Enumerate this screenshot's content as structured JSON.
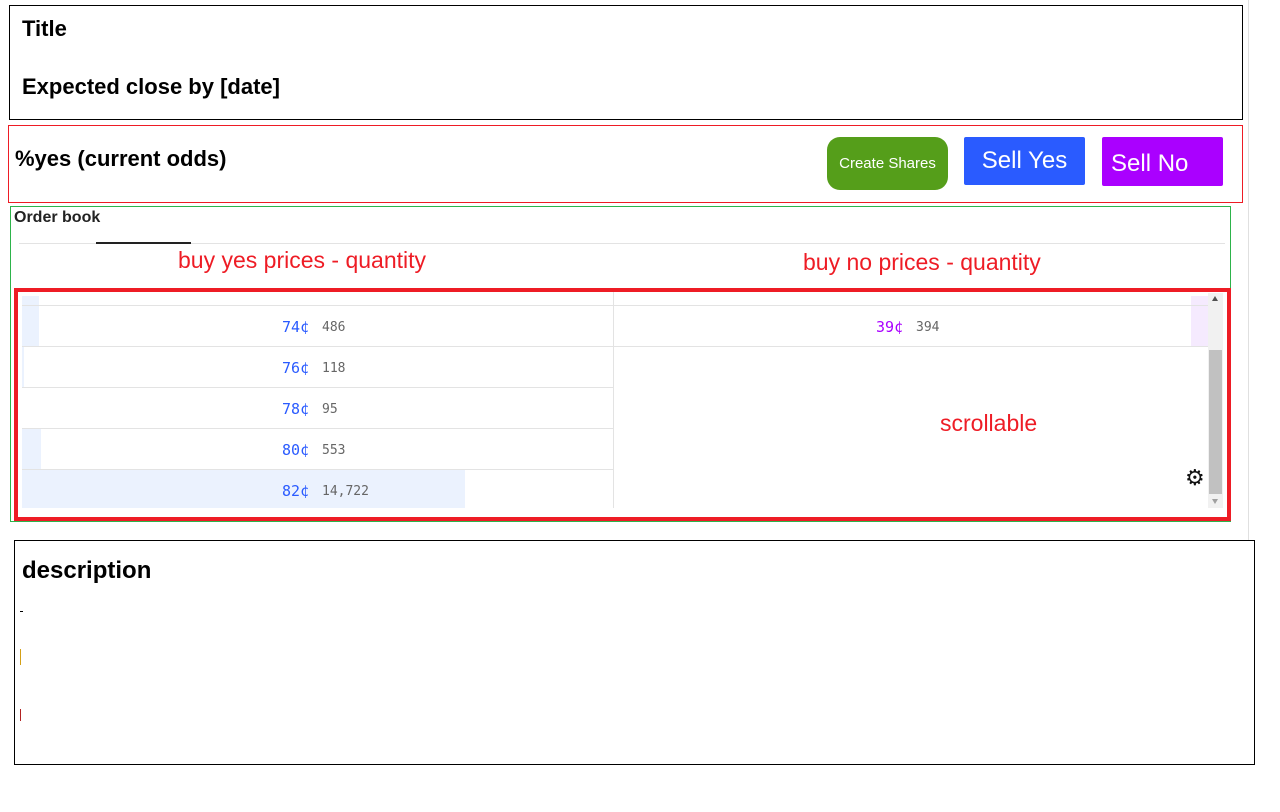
{
  "header": {
    "title": "Title",
    "expected_close": "Expected close by [date]"
  },
  "odds": {
    "label": "%yes (current odds)",
    "buttons": {
      "create_shares": "Create Shares",
      "sell_yes": "Sell Yes",
      "sell_no": "Sell No"
    }
  },
  "order_book": {
    "title": "Order book",
    "yes_header": "buy yes prices - quantity",
    "no_header": "buy no prices - quantity",
    "scroll_note": "scrollable",
    "yes_rows": [
      {
        "price": "74¢",
        "quantity": "486"
      },
      {
        "price": "76¢",
        "quantity": "118"
      },
      {
        "price": "78¢",
        "quantity": "95"
      },
      {
        "price": "80¢",
        "quantity": "553"
      },
      {
        "price": "82¢",
        "quantity": "14,722"
      }
    ],
    "no_rows": [
      {
        "price": "39¢",
        "quantity": "394"
      }
    ]
  },
  "description": {
    "title": "description"
  },
  "colors": {
    "create": "#559e1a",
    "sell_yes": "#2a5bff",
    "sell_no": "#aa00ff",
    "yes_price": "#2a5bff",
    "no_price": "#aa00ff",
    "annotation": "#ee1c25"
  }
}
